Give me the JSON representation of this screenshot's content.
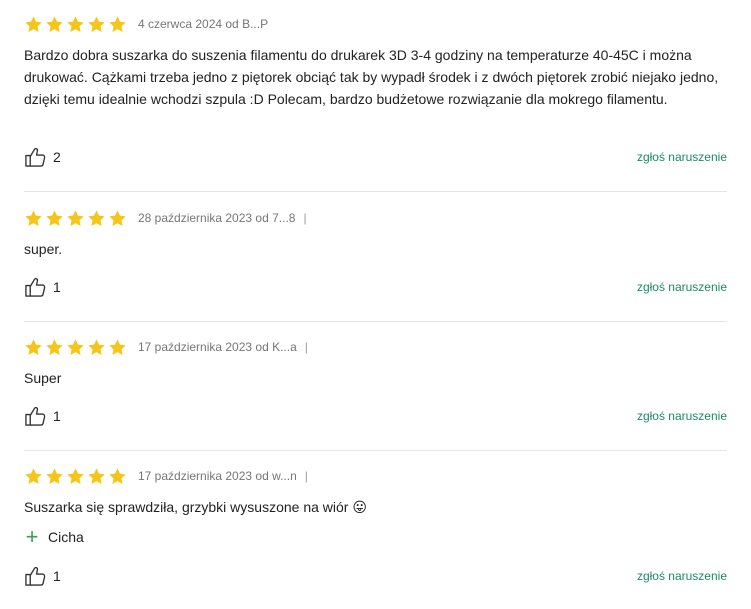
{
  "reviews": [
    {
      "rating": 5,
      "meta": "4 czerwca 2024 od B...P",
      "text": "Bardzo dobra suszarka do suszenia filamentu do drukarek 3D 3-4 godziny na temperaturze 40-45C i można drukować. Cążkami trzeba jedno z piętorek obciąć tak by wypadł środek i z dwóch piętorek zrobić niejako jedno, dzięki temu idealnie wchodzi szpula :D Polecam, bardzo budżetowe rozwiązanie dla mokrego filamentu.",
      "likes": "2",
      "report": "zgłoś naruszenie"
    },
    {
      "rating": 5,
      "meta": "28 października 2023 od 7...8",
      "separator": "|",
      "text": "super.",
      "likes": "1",
      "report": "zgłoś naruszenie"
    },
    {
      "rating": 5,
      "meta": "17 października 2023 od K...a",
      "separator": "|",
      "text": "Super",
      "likes": "1",
      "report": "zgłoś naruszenie"
    },
    {
      "rating": 5,
      "meta": "17 października 2023 od w...n",
      "separator": "|",
      "text": "Suszarka się sprawdziła, grzybki wysuszone na wiór 😛",
      "pro": "Cicha",
      "likes": "1",
      "report": "zgłoś naruszenie"
    }
  ],
  "colors": {
    "star": "#f5c518",
    "link": "#1a8a65",
    "plus": "#3aa34a",
    "divider": "#e4e4e4"
  },
  "icons": {
    "star": "star-icon",
    "like": "thumbs-up-icon",
    "plus": "plus-icon"
  }
}
